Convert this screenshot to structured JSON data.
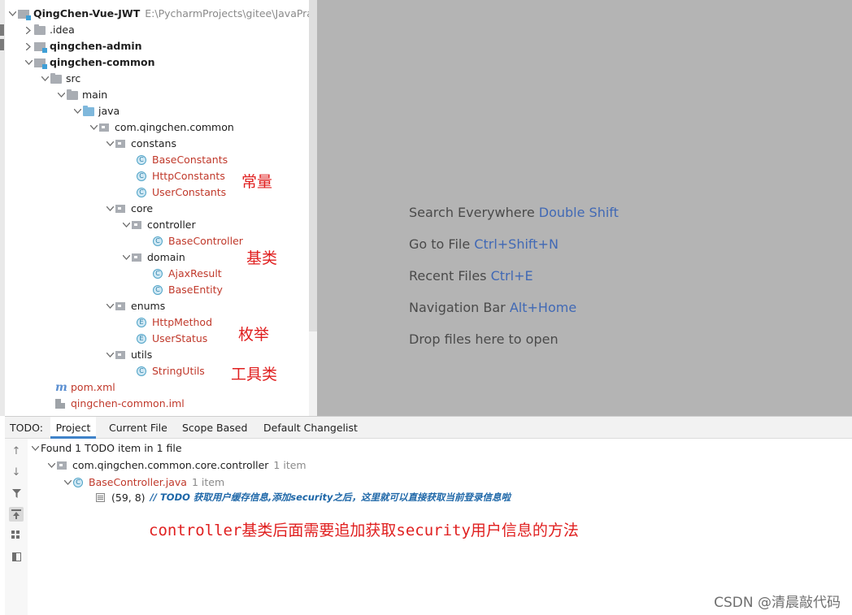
{
  "project_tree": {
    "root": {
      "label": "QingChen-Vue-JWT",
      "path": "E:\\PycharmProjects\\gitee\\JavaPractice"
    },
    "items": [
      {
        "label": ".idea"
      },
      {
        "label": "qingchen-admin"
      },
      {
        "label": "qingchen-common"
      },
      {
        "label": "src"
      },
      {
        "label": "main"
      },
      {
        "label": "java"
      },
      {
        "label": "com.qingchen.common"
      },
      {
        "label": "constans"
      },
      {
        "label": "BaseConstants"
      },
      {
        "label": "HttpConstants"
      },
      {
        "label": "UserConstants"
      },
      {
        "label": "core"
      },
      {
        "label": "controller"
      },
      {
        "label": "BaseController"
      },
      {
        "label": "domain"
      },
      {
        "label": "AjaxResult"
      },
      {
        "label": "BaseEntity"
      },
      {
        "label": "enums"
      },
      {
        "label": "HttpMethod"
      },
      {
        "label": "UserStatus"
      },
      {
        "label": "utils"
      },
      {
        "label": "StringUtils"
      },
      {
        "label": "pom.xml"
      },
      {
        "label": "qingchen-common.iml"
      }
    ],
    "icon_glyphs": {
      "class": "C",
      "enum": "E",
      "maven": "m"
    }
  },
  "annotations": {
    "constants": "常量",
    "base_classes": "基类",
    "enums": "枚举",
    "utils": "工具类",
    "bottom_note": "controller基类后面需要追加获取security用户信息的方法"
  },
  "editor_hints": [
    {
      "text": "Search Everywhere",
      "key": "Double Shift"
    },
    {
      "text": "Go to File",
      "key": "Ctrl+Shift+N"
    },
    {
      "text": "Recent Files",
      "key": "Ctrl+E"
    },
    {
      "text": "Navigation Bar",
      "key": "Alt+Home"
    },
    {
      "text": "Drop files here to open",
      "key": ""
    }
  ],
  "todo_panel": {
    "title": "TODO:",
    "tabs": [
      "Project",
      "Current File",
      "Scope Based",
      "Default Changelist"
    ],
    "active_tab": "Project",
    "summary": "Found 1 TODO item in 1 file",
    "package": {
      "label": "com.qingchen.common.core.controller",
      "count": "1 item"
    },
    "file": {
      "label": "BaseController.java",
      "count": "1 item"
    },
    "todo_item": {
      "position": "(59, 8)",
      "text": "// TODO 获取用户缓存信息,添加security之后，这里就可以直接获取当前登录信息啦"
    }
  },
  "watermark": "CSDN @清晨敲代码",
  "colors": {
    "editor_bg": "#b4b4b4",
    "hint_key": "#4169b5",
    "annotation_red": "#e02020",
    "todo_blue": "#1e67a8",
    "file_red": "#c0392b"
  }
}
